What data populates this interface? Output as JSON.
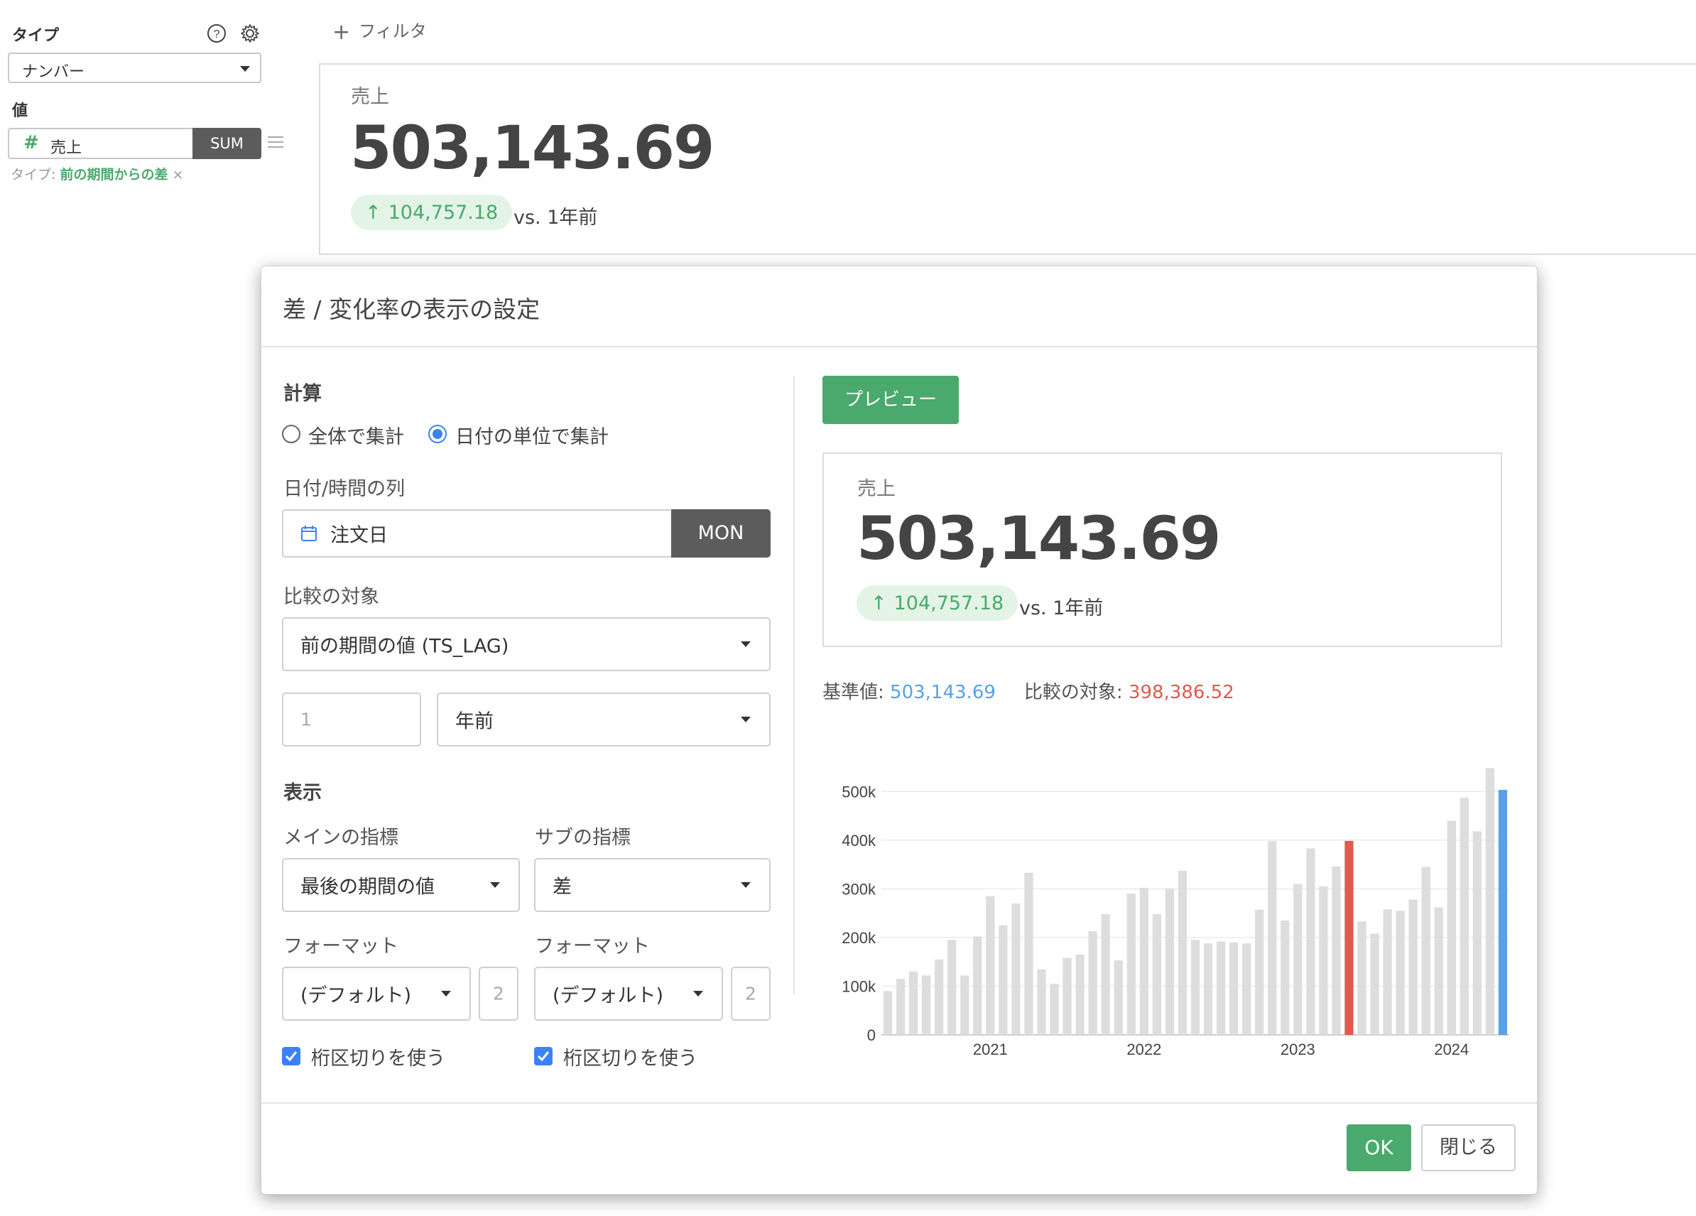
{
  "left_panel": {
    "type_label": "タイプ",
    "type_value": "ナンバー",
    "value_label": "値",
    "value_field": "売上",
    "aggregation": "SUM",
    "type_note_prefix": "タイプ: ",
    "type_note_value": "前の期間からの差",
    "type_note_remove": "×"
  },
  "toolbar": {
    "filter_label": "フィルタ"
  },
  "main_card": {
    "label": "売上",
    "value": "503,143.69",
    "diff": "104,757.18",
    "comparison": "vs. 1年前"
  },
  "dialog": {
    "title": "差 / 変化率の表示の設定",
    "calc_section": "計算",
    "radio_total": "全体で集計",
    "radio_date_unit": "日付の単位で集計",
    "radio_selected": "date_unit",
    "date_column_label": "日付/時間の列",
    "date_column_value": "注文日",
    "date_unit": "MON",
    "compare_label": "比較の対象",
    "compare_value": "前の期間の値 (TS_LAG)",
    "lag_placeholder": "1",
    "lag_unit": "年前",
    "display_section": "表示",
    "main_metric_label": "メインの指標",
    "main_metric_value": "最後の期間の値",
    "sub_metric_label": "サブの指標",
    "sub_metric_value": "差",
    "format_label_main": "フォーマット",
    "format_value_main": "(デフォルト)",
    "decimals_main_placeholder": "2",
    "format_label_sub": "フォーマット",
    "format_value_sub": "(デフォルト)",
    "decimals_sub_placeholder": "2",
    "separator_main": "桁区切りを使う",
    "separator_sub": "桁区切りを使う",
    "separator_main_checked": true,
    "separator_sub_checked": true,
    "preview_button": "プレビュー",
    "preview_card": {
      "label": "売上",
      "value": "503,143.69",
      "diff": "104,757.18",
      "comparison": "vs. 1年前"
    },
    "base_label": "基準値: ",
    "base_value": "503,143.69",
    "compare_stat_label": "比較の対象: ",
    "compare_stat_value": "398,386.52",
    "ok_button": "OK",
    "close_button": "閉じる"
  },
  "colors": {
    "accent_green": "#4aa96c",
    "bar_default": "#dddddd",
    "bar_compare": "#e05a4f",
    "bar_base": "#5aa0e8"
  },
  "chart_data": {
    "type": "bar",
    "ylim": [
      0,
      550000
    ],
    "y_ticks": [
      "0",
      "100k",
      "200k",
      "300k",
      "400k",
      "500k"
    ],
    "y_tick_values": [
      0,
      100000,
      200000,
      300000,
      400000,
      500000
    ],
    "x_tick_labels": [
      "2021",
      "2022",
      "2023",
      "2024"
    ],
    "x_tick_indices": [
      8,
      20,
      32,
      44
    ],
    "grid": true,
    "values": [
      90000,
      115000,
      130000,
      122000,
      155000,
      195000,
      122000,
      202000,
      285000,
      225000,
      270000,
      333000,
      135000,
      105000,
      158000,
      165000,
      213000,
      248000,
      153000,
      290000,
      302000,
      248000,
      300000,
      337000,
      195000,
      188000,
      192000,
      190000,
      188000,
      257000,
      398000,
      235000,
      310000,
      383000,
      305000,
      346000,
      398387,
      233000,
      208000,
      258000,
      255000,
      278000,
      345000,
      262000,
      440000,
      487000,
      418000,
      548000,
      503144
    ],
    "compare_index": 36,
    "base_index": 48
  }
}
